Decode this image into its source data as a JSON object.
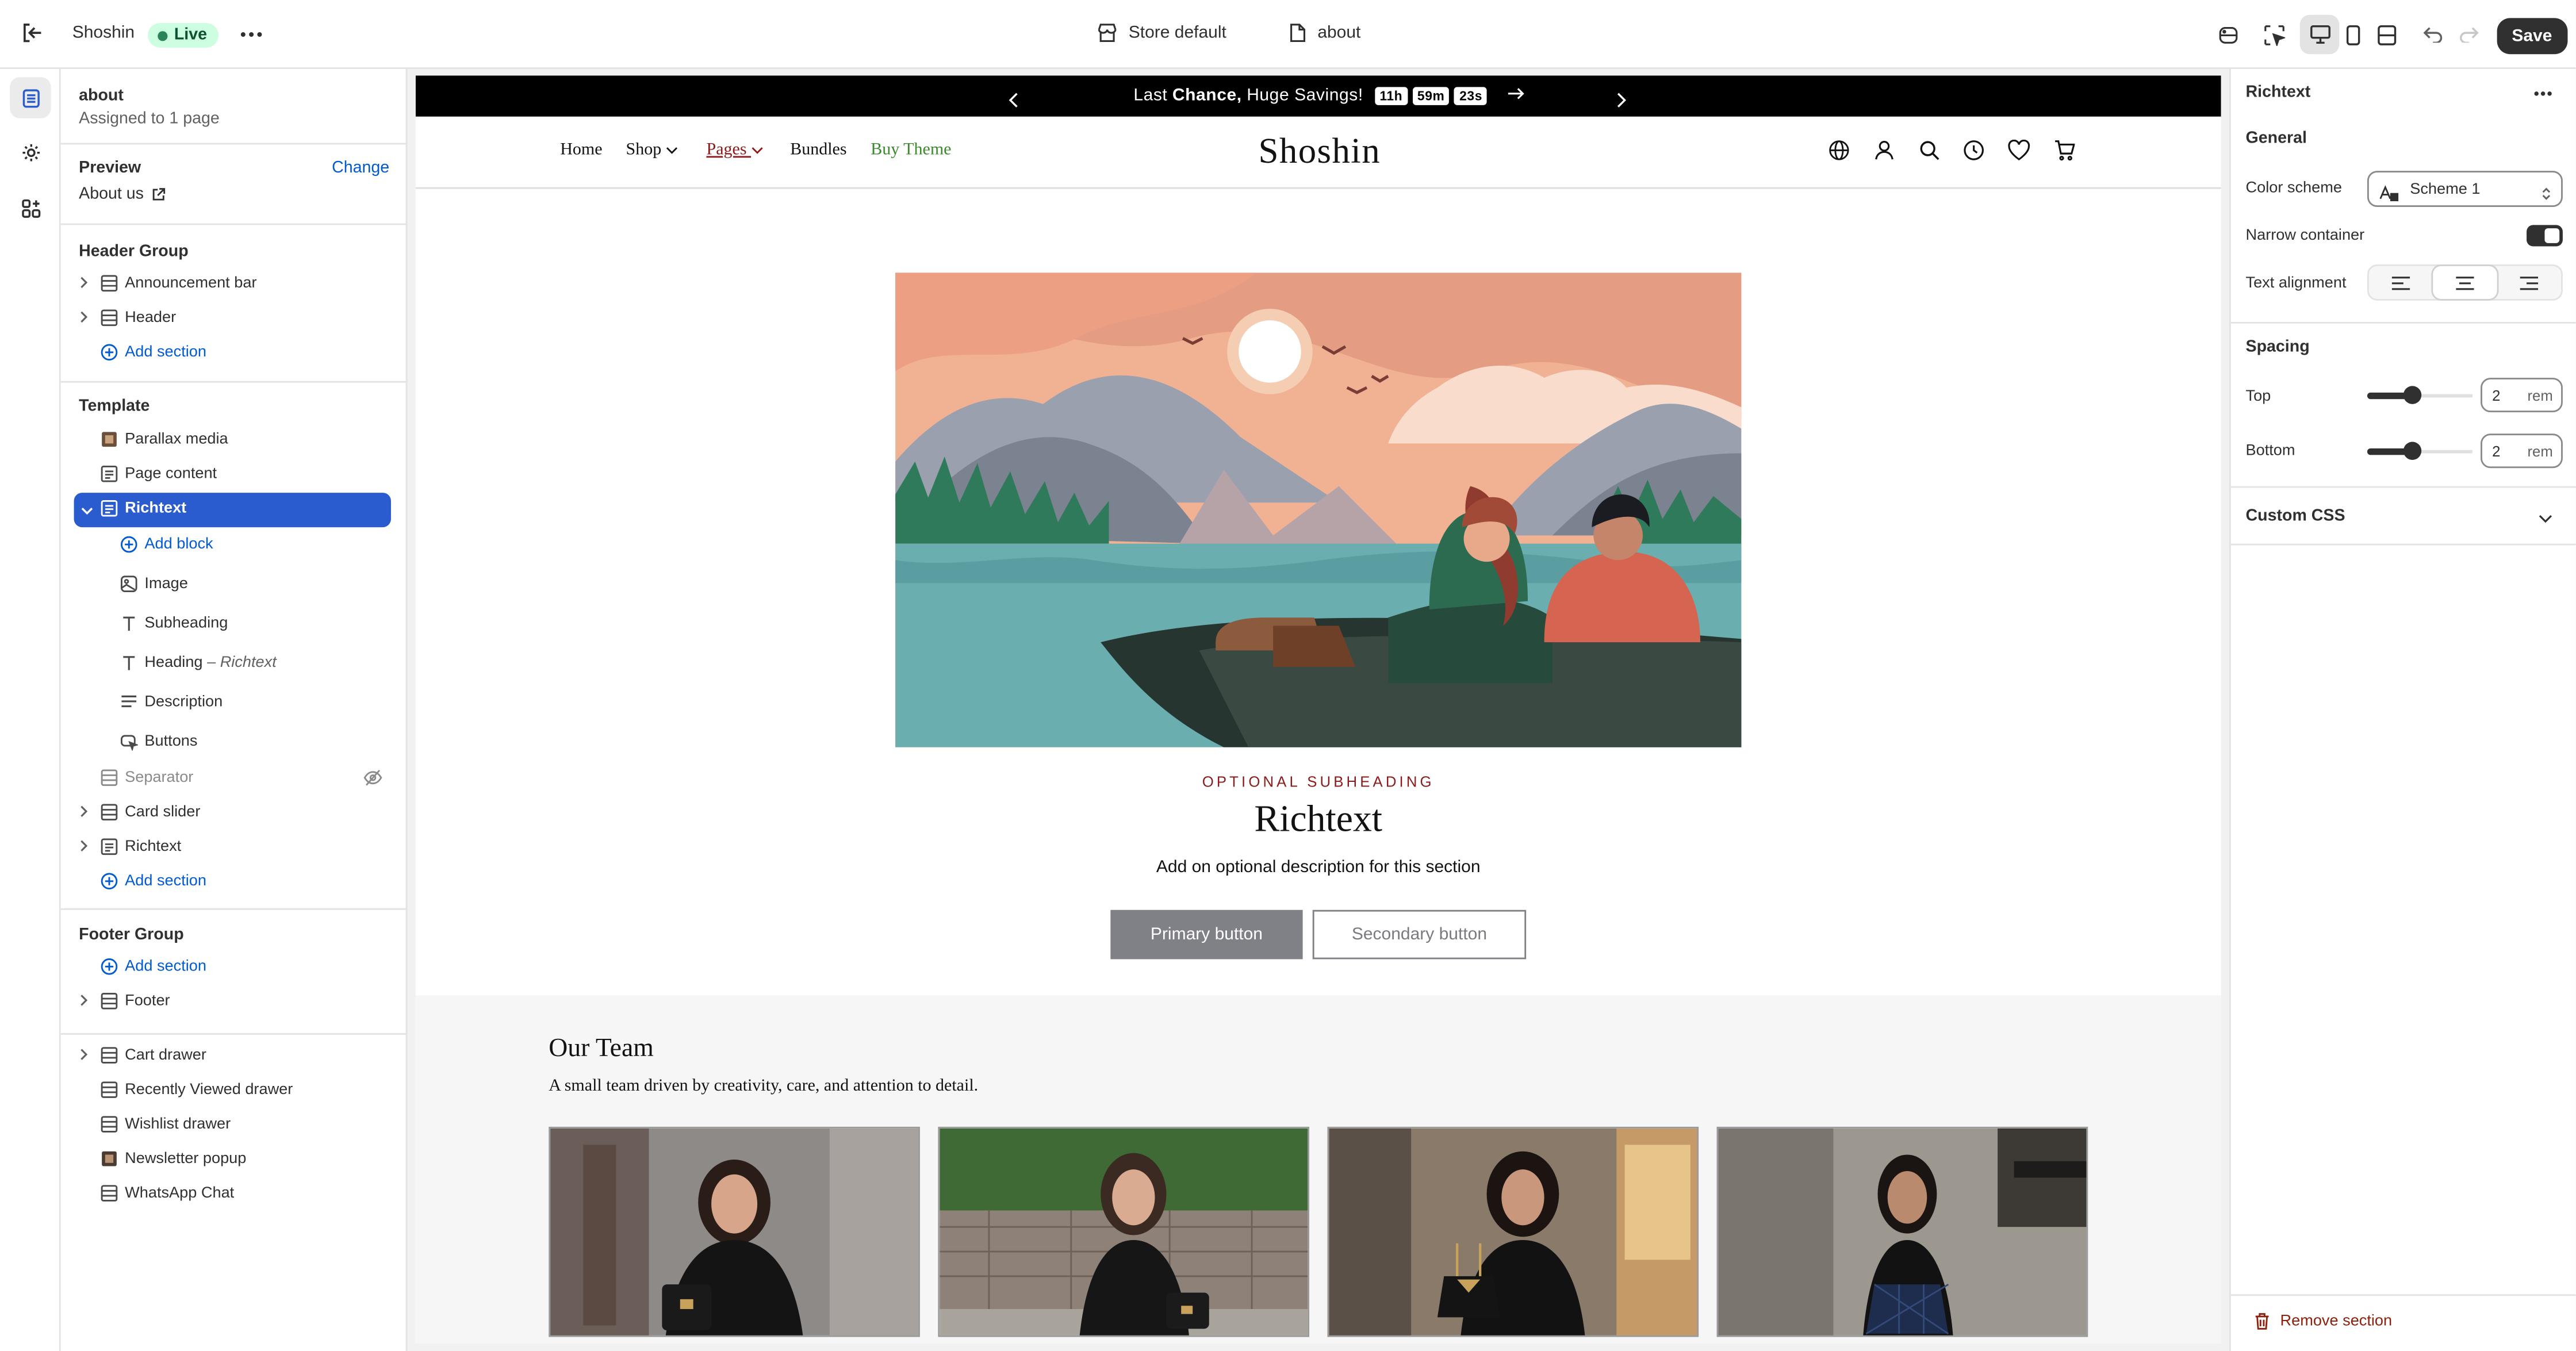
{
  "topbar": {
    "theme_name": "Shoshin",
    "live_label": "Live",
    "store_label": "Store default",
    "page_label": "about",
    "save_label": "Save"
  },
  "left_panel": {
    "page_title": "about",
    "assigned": "Assigned to 1 page",
    "preview_label": "Preview",
    "change_label": "Change",
    "preview_value": "About us",
    "header_group": {
      "title": "Header Group",
      "items": [
        "Announcement bar",
        "Header"
      ],
      "add": "Add section"
    },
    "template": {
      "title": "Template",
      "items": [
        "Parallax media",
        "Page content",
        "Richtext"
      ],
      "add_block": "Add block",
      "blocks": [
        "Image",
        "Subheading",
        "Heading",
        "Description",
        "Buttons"
      ],
      "heading_suffix": "– Richtext",
      "after": [
        "Separator",
        "Card slider",
        "Richtext"
      ],
      "add": "Add section"
    },
    "footer_group": {
      "title": "Footer Group",
      "add": "Add section",
      "items": [
        "Footer"
      ]
    },
    "overlays": [
      "Cart drawer",
      "Recently Viewed drawer",
      "Wishlist drawer",
      "Newsletter popup",
      "WhatsApp Chat"
    ]
  },
  "preview": {
    "announcement": {
      "pre": "Last",
      "bold": "Chance,",
      "post": "Huge Savings!",
      "timer": [
        "11h",
        "59m",
        "23s"
      ]
    },
    "nav": [
      "Home",
      "Shop",
      "Pages",
      "Bundles",
      "Buy Theme"
    ],
    "logo": "Shoshin",
    "subheading": "OPTIONAL SUBHEADING",
    "title": "Richtext",
    "description": "Add on optional description for this section",
    "primary_button": "Primary button",
    "secondary_button": "Secondary button",
    "team_title": "Our Team",
    "team_subtitle": "A small team driven by creativity, care, and attention to detail."
  },
  "right_panel": {
    "title": "Richtext",
    "general": "General",
    "color_scheme_label": "Color scheme",
    "color_scheme_value": "Scheme 1",
    "narrow_label": "Narrow container",
    "narrow_on": true,
    "alignment_label": "Text alignment",
    "alignment_selected": "center",
    "spacing": "Spacing",
    "top_label": "Top",
    "top_value": "2",
    "bottom_label": "Bottom",
    "bottom_value": "2",
    "unit": "rem",
    "spacing_fraction": 0.42,
    "custom_css": "Custom CSS",
    "remove": "Remove section"
  }
}
